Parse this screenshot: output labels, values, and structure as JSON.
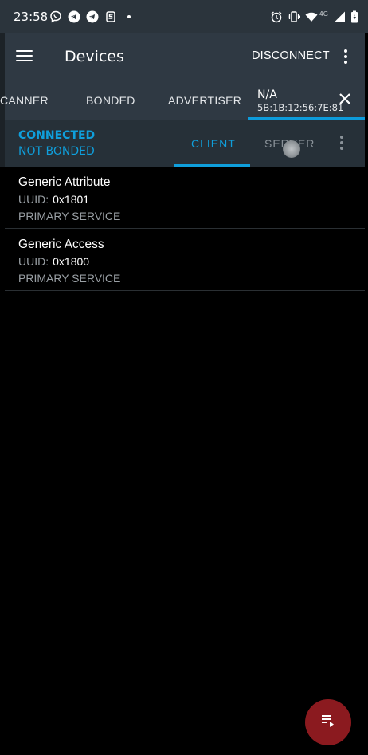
{
  "status_bar": {
    "time": "23:58",
    "network": "4G",
    "icons_left": [
      "viber-icon",
      "telegram-icon",
      "telegram-icon",
      "app-notification-icon",
      "more-notifications-dot"
    ],
    "icons_right": [
      "alarm-icon",
      "vibrate-icon",
      "wifi-icon",
      "signal-icon",
      "battery-icon"
    ]
  },
  "toolbar": {
    "title": "Devices",
    "disconnect_label": "DISCONNECT"
  },
  "top_tabs": {
    "scanner": "CANNER",
    "bonded": "BONDED",
    "advertiser": "ADVERTISER",
    "device": {
      "name": "N/A",
      "address": "5B:1B:12:56:7E:81"
    }
  },
  "connection": {
    "status": "CONNECTED",
    "bond": "NOT BONDED",
    "tabs": {
      "client": "CLIENT",
      "server": "SERVER"
    }
  },
  "services": [
    {
      "name": "Generic Attribute",
      "uuid_label": "UUID:",
      "uuid": "0x1801",
      "type": "PRIMARY SERVICE"
    },
    {
      "name": "Generic Access",
      "uuid_label": "UUID:",
      "uuid": "0x1800",
      "type": "PRIMARY SERVICE"
    }
  ],
  "colors": {
    "accent": "#0f9fdc",
    "toolbar": "#2f3943",
    "status_bar": "#2b343c",
    "fab": "#8b1a1f"
  }
}
